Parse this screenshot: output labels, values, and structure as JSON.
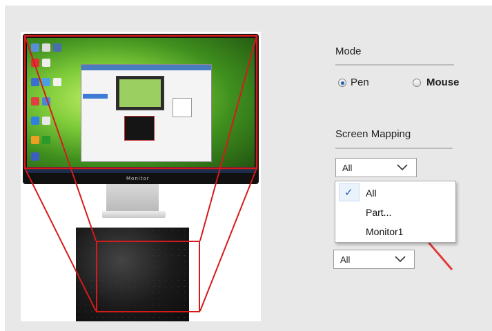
{
  "monitor_label": "Monitor",
  "mode": {
    "title": "Mode",
    "options": [
      {
        "label": "Pen",
        "selected": true
      },
      {
        "label": "Mouse",
        "selected": false
      }
    ]
  },
  "screen_mapping": {
    "title": "Screen Mapping",
    "select_value": "All",
    "dropdown_items": [
      {
        "label": "All",
        "checked": true
      },
      {
        "label": "Part...",
        "checked": false
      },
      {
        "label": "Monitor1",
        "checked": false
      }
    ],
    "second_select_value": "All"
  },
  "colors": {
    "highlight_red": "#d61a1a",
    "radio_blue": "#1f5fbf",
    "panel_bg": "#e8e8e8"
  },
  "icons": [
    "chevron-down-icon",
    "checkmark-icon",
    "red-arrow-pointer"
  ]
}
